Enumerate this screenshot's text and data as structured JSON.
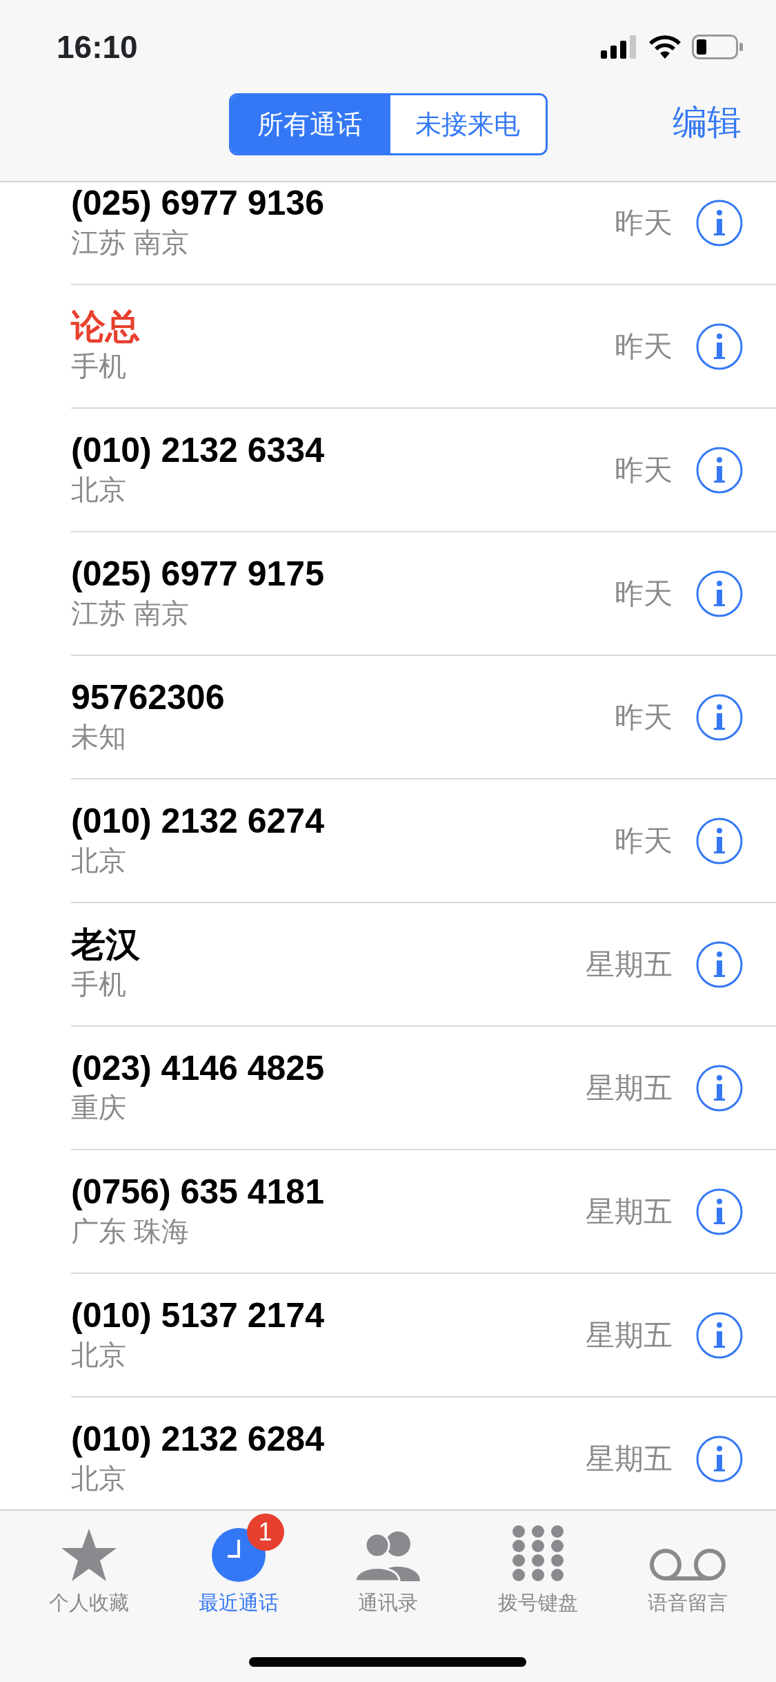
{
  "status_bar": {
    "time": "16:10"
  },
  "segments": [
    {
      "label": "所有通话",
      "selected": true
    },
    {
      "label": "未接来电",
      "selected": false
    }
  ],
  "edit_button": "编辑",
  "calls": [
    {
      "name": "(025) 6977 9136",
      "detail": "江苏 南京",
      "date": "昨天",
      "missed": false
    },
    {
      "name": "论总",
      "detail": "手机",
      "date": "昨天",
      "missed": true
    },
    {
      "name": "(010) 2132 6334",
      "detail": "北京",
      "date": "昨天",
      "missed": false
    },
    {
      "name": "(025) 6977 9175",
      "detail": "江苏 南京",
      "date": "昨天",
      "missed": false
    },
    {
      "name": "95762306",
      "detail": "未知",
      "date": "昨天",
      "missed": false
    },
    {
      "name": "(010) 2132 6274",
      "detail": "北京",
      "date": "昨天",
      "missed": false
    },
    {
      "name": "老汉",
      "detail": "手机",
      "date": "星期五",
      "missed": false
    },
    {
      "name": "(023) 4146 4825",
      "detail": "重庆",
      "date": "星期五",
      "missed": false
    },
    {
      "name": "(0756) 635 4181",
      "detail": "广东 珠海",
      "date": "星期五",
      "missed": false
    },
    {
      "name": "(010) 5137 2174",
      "detail": "北京",
      "date": "星期五",
      "missed": false
    },
    {
      "name": "(010) 2132 6284",
      "detail": "北京",
      "date": "星期五",
      "missed": false
    }
  ],
  "tab_bar": [
    {
      "label": "个人收藏",
      "kind": "star",
      "selected": false
    },
    {
      "label": "最近通话",
      "kind": "clock",
      "selected": true,
      "badge": "1"
    },
    {
      "label": "通讯录",
      "kind": "contacts",
      "selected": false
    },
    {
      "label": "拨号键盘",
      "kind": "keypad",
      "selected": false
    },
    {
      "label": "语音留言",
      "kind": "voicemail",
      "selected": false
    }
  ]
}
